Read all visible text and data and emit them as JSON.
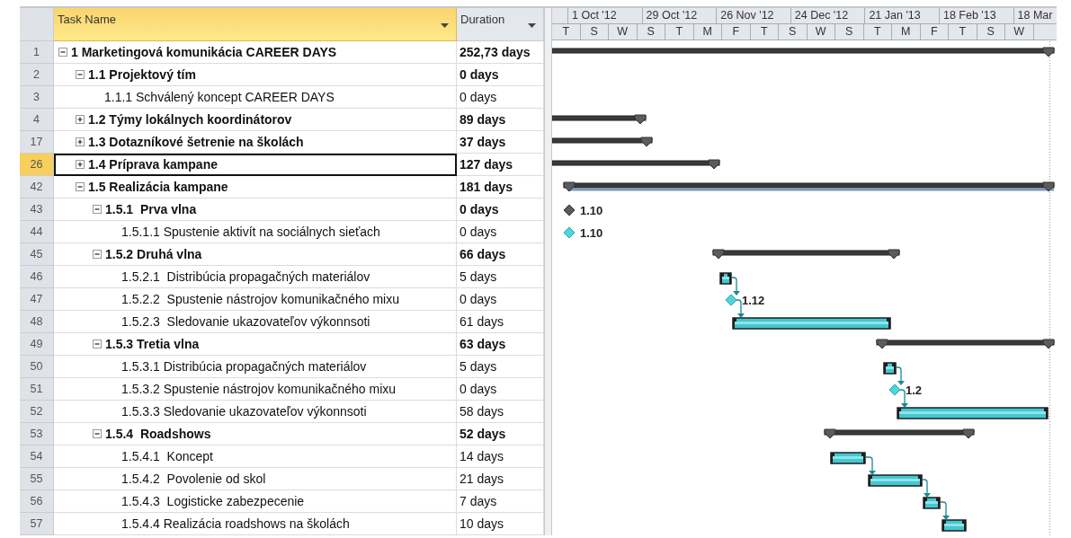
{
  "columns": [
    {
      "label": "Task Name",
      "selected": true
    },
    {
      "label": "Duration",
      "selected": false
    }
  ],
  "timescale": {
    "major": [
      "1 Oct '12",
      "29 Oct '12",
      "26 Nov '12",
      "24 Dec '12",
      "21 Jan '13",
      "18 Feb '13",
      "18 Mar"
    ],
    "minor": [
      "T",
      "S",
      "W",
      "S",
      "T",
      "M",
      "F",
      "T",
      "S",
      "W",
      "S",
      "T",
      "M",
      "F",
      "T",
      "S",
      "W"
    ]
  },
  "tasks": [
    {
      "id": "1",
      "name": "1 Marketingová komunikácia CAREER DAYS",
      "duration": "252,73 days",
      "kind": "summary",
      "expanded": true,
      "selected": false,
      "children": [
        {
          "id": "2",
          "name": "1.1 Projektový tím",
          "duration": "0 days",
          "kind": "summary",
          "expanded": true,
          "selected": false,
          "children": [
            {
              "id": "3",
              "name": "1.1.1 Schválený koncept CAREER DAYS",
              "duration": "0 days",
              "kind": "milestone",
              "selected": false
            }
          ]
        },
        {
          "id": "4",
          "name": "1.2 Týmy lokálnych koordinátorov",
          "duration": "89 days",
          "kind": "summary",
          "expanded": false,
          "selected": false
        },
        {
          "id": "17",
          "name": "1.3 Dotazníkové šetrenie na školách",
          "duration": "37 days",
          "kind": "summary",
          "expanded": false,
          "selected": false
        },
        {
          "id": "26",
          "name": "1.4 Príprava kampane",
          "duration": "127 days",
          "kind": "summary",
          "expanded": false,
          "selected": true
        },
        {
          "id": "42",
          "name": "1.5 Realizácia kampane",
          "duration": "181 days",
          "kind": "summary",
          "expanded": true,
          "selected": false,
          "children": [
            {
              "id": "43",
              "name": "1.5.1  Prva vlna",
              "duration": "0 days",
              "kind": "summary",
              "expanded": true,
              "selected": false,
              "bar_label": "1.10",
              "children": [
                {
                  "id": "44",
                  "name": "1.5.1.1 Spustenie aktivít na sociálnych sieťach",
                  "duration": "0 days",
                  "kind": "milestone",
                  "selected": false,
                  "bar_label": "1.10"
                }
              ]
            },
            {
              "id": "45",
              "name": "1.5.2 Druhá vlna",
              "duration": "66 days",
              "kind": "summary",
              "expanded": true,
              "selected": false,
              "children": [
                {
                  "id": "46",
                  "name": "1.5.2.1  Distribúcia propagačných materiálov",
                  "duration": "5 days",
                  "kind": "task",
                  "selected": false
                },
                {
                  "id": "47",
                  "name": "1.5.2.2  Spustenie nástrojov komunikačného mixu",
                  "duration": "0 days",
                  "kind": "milestone",
                  "selected": false,
                  "bar_label": "1.12"
                },
                {
                  "id": "48",
                  "name": "1.5.2.3  Sledovanie ukazovateľov výkonnsoti",
                  "duration": "61 days",
                  "kind": "task",
                  "selected": false
                }
              ]
            },
            {
              "id": "49",
              "name": "1.5.3 Tretia vlna",
              "duration": "63 days",
              "kind": "summary",
              "expanded": true,
              "selected": false,
              "children": [
                {
                  "id": "50",
                  "name": "1.5.3.1 Distribúcia propagačných materiálov",
                  "duration": "5 days",
                  "kind": "task",
                  "selected": false
                },
                {
                  "id": "51",
                  "name": "1.5.3.2 Spustenie nástrojov komunikačného mixu",
                  "duration": "0 days",
                  "kind": "milestone",
                  "selected": false,
                  "bar_label": "1.2"
                },
                {
                  "id": "52",
                  "name": "1.5.3.3 Sledovanie ukazovateľov výkonnsoti",
                  "duration": "58 days",
                  "kind": "task",
                  "selected": false
                }
              ]
            },
            {
              "id": "53",
              "name": "1.5.4  Roadshows",
              "duration": "52 days",
              "kind": "summary",
              "expanded": true,
              "selected": false,
              "children": [
                {
                  "id": "54",
                  "name": "1.5.4.1  Koncept",
                  "duration": "14 days",
                  "kind": "task",
                  "selected": false
                },
                {
                  "id": "55",
                  "name": "1.5.4.2  Povolenie od skol",
                  "duration": "21 days",
                  "kind": "task",
                  "selected": false
                },
                {
                  "id": "56",
                  "name": "1.5.4.3  Logisticke zabezpecenie",
                  "duration": "7 days",
                  "kind": "task",
                  "selected": false
                },
                {
                  "id": "57",
                  "name": "1.5.4.4 Realizácia roadshows na školách",
                  "duration": "10 days",
                  "kind": "task",
                  "selected": false
                }
              ]
            }
          ]
        }
      ]
    }
  ]
}
